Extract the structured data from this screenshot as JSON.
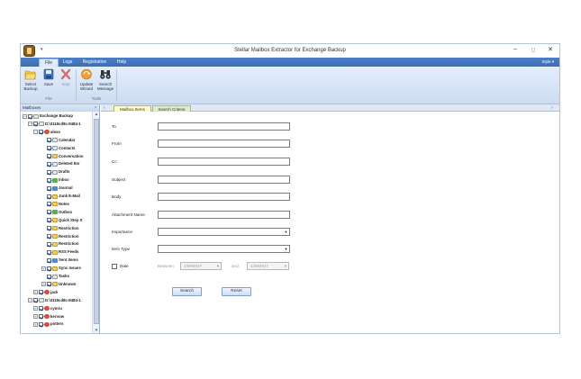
{
  "window": {
    "title": "Stellar Mailbox Extractor for Exchange Backup",
    "controls": {
      "minimize": "–",
      "maximize": "▢",
      "close": "✕"
    }
  },
  "ribbon_tabs": [
    "File",
    "Logs",
    "Registration",
    "Help"
  ],
  "active_tab": "File",
  "style_link": "Style",
  "ribbon": {
    "file_group": {
      "label": "File",
      "buttons": [
        {
          "label1": "Select",
          "label2": "Backup",
          "icon": "folder-open-icon"
        },
        {
          "label1": "Save",
          "label2": "",
          "icon": "save-icon"
        },
        {
          "label1": "Stop",
          "label2": "",
          "icon": "stop-icon",
          "disabled": true
        }
      ]
    },
    "tools_group": {
      "label": "Tools",
      "buttons": [
        {
          "label1": "Update",
          "label2": "Wizard",
          "icon": "update-icon"
        },
        {
          "label1": "Search",
          "label2": "Message",
          "icon": "binoculars-icon"
        }
      ]
    }
  },
  "mailboxes_panel": {
    "title": "Mailboxes",
    "pin": "ᵖ",
    "tree": [
      {
        "label": "Exchange Backup",
        "level": 0,
        "expander": "−",
        "icon": "root"
      },
      {
        "label": "D:\\3119cd8c-9484-1",
        "level": 1,
        "expander": "−",
        "icon": "doc"
      },
      {
        "label": "alexo",
        "level": 2,
        "expander": "−",
        "icon": "user"
      },
      {
        "label": "Calendar",
        "level": 3,
        "expander": "",
        "icon": "doc"
      },
      {
        "label": "Contacts",
        "level": 3,
        "expander": "",
        "icon": "doc"
      },
      {
        "label": "Conversation",
        "level": 3,
        "expander": "",
        "icon": "folder"
      },
      {
        "label": "Deleted Iter",
        "level": 3,
        "expander": "",
        "icon": "doc"
      },
      {
        "label": "Drafts",
        "level": 3,
        "expander": "",
        "icon": "doc"
      },
      {
        "label": "Inbox",
        "level": 3,
        "expander": "",
        "icon": "green"
      },
      {
        "label": "Journal",
        "level": 3,
        "expander": "",
        "icon": "blue"
      },
      {
        "label": "Junk E-Mail",
        "level": 3,
        "expander": "",
        "icon": "folder"
      },
      {
        "label": "Notes",
        "level": 3,
        "expander": "",
        "icon": "folder"
      },
      {
        "label": "Outbox",
        "level": 3,
        "expander": "",
        "icon": "green"
      },
      {
        "label": "Quick Step S",
        "level": 3,
        "expander": "",
        "icon": "folder"
      },
      {
        "label": "Restriction",
        "level": 3,
        "expander": "",
        "icon": "folder"
      },
      {
        "label": "Restriction",
        "level": 3,
        "expander": "",
        "icon": "folder"
      },
      {
        "label": "Restriction",
        "level": 3,
        "expander": "",
        "icon": "folder"
      },
      {
        "label": "RSS Feeds",
        "level": 3,
        "expander": "",
        "icon": "folder"
      },
      {
        "label": "Sent Items",
        "level": 3,
        "expander": "",
        "icon": "blue"
      },
      {
        "label": "Sync Issues",
        "level": 3,
        "expander": "+",
        "icon": "folder"
      },
      {
        "label": "Tasks",
        "level": 3,
        "expander": "",
        "icon": "doc"
      },
      {
        "label": "Unknown",
        "level": 3,
        "expander": "+",
        "icon": "folder"
      },
      {
        "label": "jack",
        "level": 2,
        "expander": "+",
        "icon": "user"
      },
      {
        "label": "D:\\3119cd8c-9484-1",
        "level": 1,
        "expander": "−",
        "icon": "doc"
      },
      {
        "label": "cymru",
        "level": 2,
        "expander": "+",
        "icon": "user"
      },
      {
        "label": "kernow",
        "level": 2,
        "expander": "+",
        "icon": "user"
      },
      {
        "label": "potters",
        "level": 2,
        "expander": "+",
        "icon": "user"
      }
    ]
  },
  "content_tabs": [
    "Mailbox Items",
    "Search Criteria"
  ],
  "search_form": {
    "to_label": "To",
    "from_label": "From",
    "cc_label": "Cc",
    "subject_label": "Subject",
    "body_label": "Body",
    "attachment_label": "Attachment Name",
    "importance_label": "Importance",
    "importance_value": "",
    "item_type_label": "Item Type",
    "item_type_value": "",
    "date_label": "Date",
    "between_label": "Between",
    "and_label": "and",
    "date_from": "1/29/2017",
    "date_to": "1/29/2017",
    "search_button": "Search",
    "reset_button": "Reset"
  }
}
